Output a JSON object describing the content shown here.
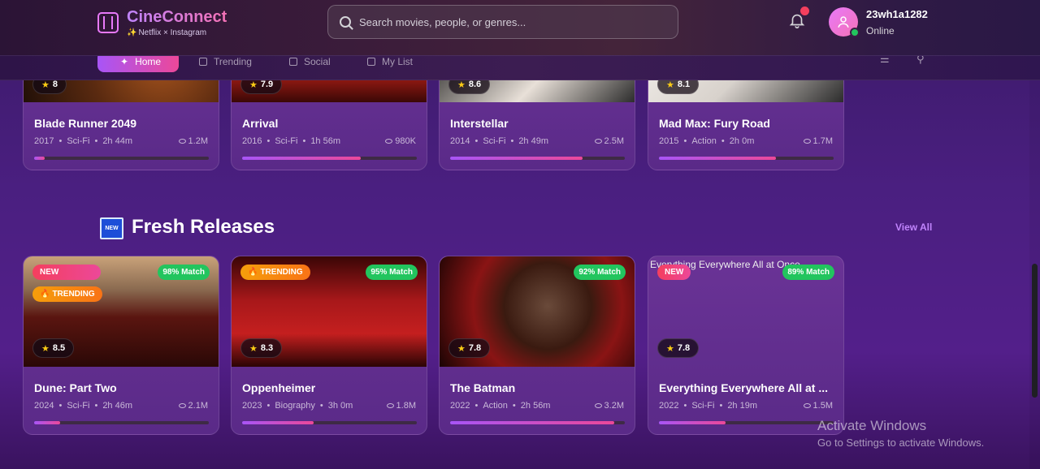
{
  "app": {
    "title": "CineConnect",
    "subtitle": "Netflix × Instagram",
    "subtitle_spark": "✨"
  },
  "search": {
    "placeholder": "Search movies, people, or genres..."
  },
  "user": {
    "name": "23wh1a1282",
    "status": "Online"
  },
  "nav": {
    "items": [
      {
        "label": "Home"
      },
      {
        "label": "Trending"
      },
      {
        "label": "Social"
      },
      {
        "label": "My List"
      }
    ]
  },
  "top_row": [
    {
      "title": "Blade Runner 2049",
      "rating": "8",
      "year": "2017",
      "genre": "Sci-Fi",
      "duration": "2h 44m",
      "views": "1.2M",
      "progress": 0.06
    },
    {
      "title": "Arrival",
      "rating": "7.9",
      "year": "2016",
      "genre": "Sci-Fi",
      "duration": "1h 56m",
      "views": "980K",
      "progress": 0.68
    },
    {
      "title": "Interstellar",
      "rating": "8.6",
      "year": "2014",
      "genre": "Sci-Fi",
      "duration": "2h 49m",
      "views": "2.5M",
      "progress": 0.76
    },
    {
      "title": "Mad Max: Fury Road",
      "rating": "8.1",
      "year": "2015",
      "genre": "Action",
      "duration": "2h 0m",
      "views": "1.7M",
      "progress": 0.67
    }
  ],
  "section": {
    "badge": "NEW",
    "title": "Fresh Releases",
    "view_all": "View All"
  },
  "fresh": [
    {
      "title": "Dune: Part Two",
      "rating": "8.5",
      "year": "2024",
      "genre": "Sci-Fi",
      "duration": "2h 46m",
      "views": "2.1M",
      "progress": 0.15,
      "match": "98% Match",
      "tag_new": "NEW",
      "tag_trending": "TRENDING"
    },
    {
      "title": "Oppenheimer",
      "rating": "8.3",
      "year": "2023",
      "genre": "Biography",
      "duration": "3h 0m",
      "views": "1.8M",
      "progress": 0.41,
      "match": "95% Match",
      "tag_trending": "TRENDING"
    },
    {
      "title": "The Batman",
      "rating": "7.8",
      "year": "2022",
      "genre": "Action",
      "duration": "2h 56m",
      "views": "3.2M",
      "progress": 0.94,
      "match": "92% Match"
    },
    {
      "title": "Everything Everywhere All at ...",
      "alt": "Everything Everywhere All at Once",
      "rating": "7.8",
      "year": "2022",
      "genre": "Sci-Fi",
      "duration": "2h 19m",
      "views": "1.5M",
      "progress": 0.38,
      "match": "89% Match",
      "tag_new": "NEW"
    }
  ],
  "meta_dot": "•",
  "star": "★",
  "fire": "🔥",
  "watermark": {
    "title": "Activate Windows",
    "sub": "Go to Settings to activate Windows."
  },
  "colors": {
    "accent_purple": "#a855f7",
    "accent_pink": "#ec4899",
    "match_green": "#22c55e",
    "online_green": "#22c55e"
  }
}
